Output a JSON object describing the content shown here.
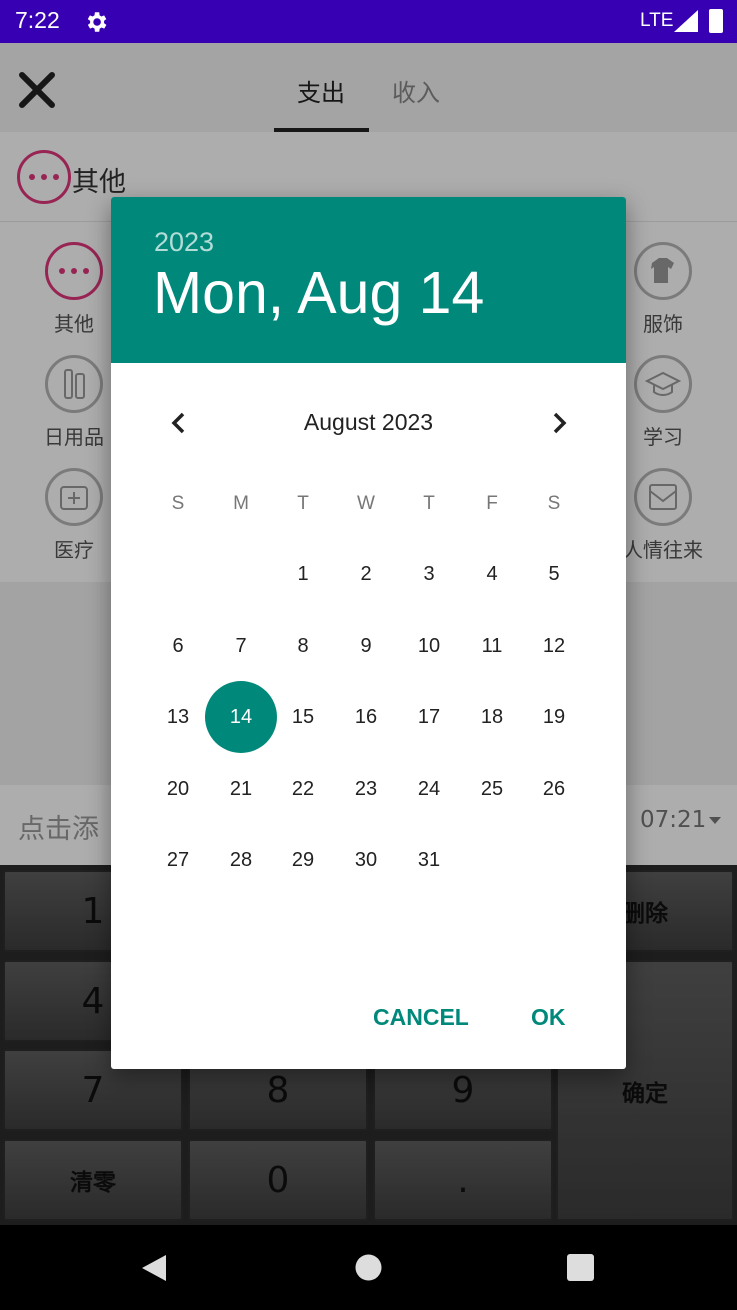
{
  "status_bar": {
    "time": "7:22",
    "network": "LTE"
  },
  "top_bar": {
    "tabs": [
      "支出",
      "收入"
    ],
    "active_tab": "支出"
  },
  "selected_category": {
    "label": "其他"
  },
  "categories": {
    "left": [
      "其他",
      "日用品",
      "医疗"
    ],
    "right": [
      "服饰",
      "学习",
      "人情往来"
    ]
  },
  "note": {
    "placeholder": "点击添",
    "time": "07:21"
  },
  "keypad": {
    "keys": [
      "1",
      "4",
      "7",
      "8",
      "9",
      "清零",
      "0",
      ".",
      "删除",
      "确定"
    ]
  },
  "date_picker": {
    "year": "2023",
    "date": "Mon, Aug 14",
    "month_title": "August 2023",
    "weekdays": [
      "S",
      "M",
      "T",
      "W",
      "T",
      "F",
      "S"
    ],
    "days": [
      "1",
      "2",
      "3",
      "4",
      "5",
      "6",
      "7",
      "8",
      "9",
      "10",
      "11",
      "12",
      "13",
      "14",
      "15",
      "16",
      "17",
      "18",
      "19",
      "20",
      "21",
      "22",
      "23",
      "24",
      "25",
      "26",
      "27",
      "28",
      "29",
      "30",
      "31"
    ],
    "first_weekday_index": 2,
    "selected_day": "14",
    "cancel_label": "CANCEL",
    "ok_label": "OK",
    "accent_color": "#00897b"
  },
  "icons": [
    "settings-gear-icon",
    "signal-icon",
    "battery-icon",
    "close-icon",
    "more-dots-icon",
    "tshirt-icon",
    "toiletries-icon",
    "graduation-cap-icon",
    "medical-kit-icon",
    "red-envelope-icon",
    "chevron-left-icon",
    "chevron-right-icon",
    "back-icon",
    "home-icon",
    "recents-icon"
  ]
}
